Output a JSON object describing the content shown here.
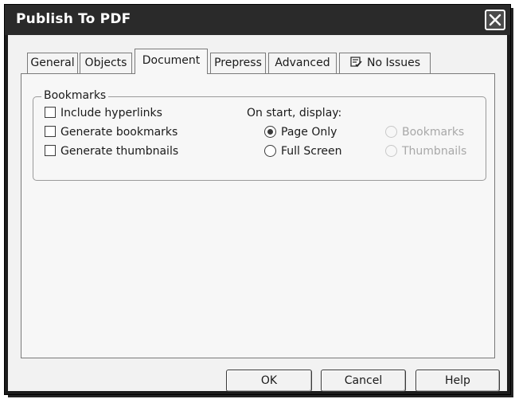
{
  "window": {
    "title": "Publish To PDF"
  },
  "tabs": [
    {
      "label": "General"
    },
    {
      "label": "Objects"
    },
    {
      "label": "Document"
    },
    {
      "label": "Prepress"
    },
    {
      "label": "Advanced"
    },
    {
      "label": "No Issues",
      "icon": "issues-icon"
    }
  ],
  "active_tab": "Document",
  "bookmarks": {
    "group_label": "Bookmarks",
    "checkboxes": [
      {
        "label": "Include hyperlinks",
        "checked": false
      },
      {
        "label": "Generate bookmarks",
        "checked": false
      },
      {
        "label": "Generate thumbnails",
        "checked": false
      }
    ],
    "display_label": "On start, display:",
    "radios": [
      {
        "label": "Page Only",
        "checked": true,
        "enabled": true
      },
      {
        "label": "Full Screen",
        "checked": false,
        "enabled": true
      },
      {
        "label": "Bookmarks",
        "checked": false,
        "enabled": false
      },
      {
        "label": "Thumbnails",
        "checked": false,
        "enabled": false
      }
    ]
  },
  "buttons": {
    "ok": "OK",
    "cancel": "Cancel",
    "help": "Help"
  }
}
